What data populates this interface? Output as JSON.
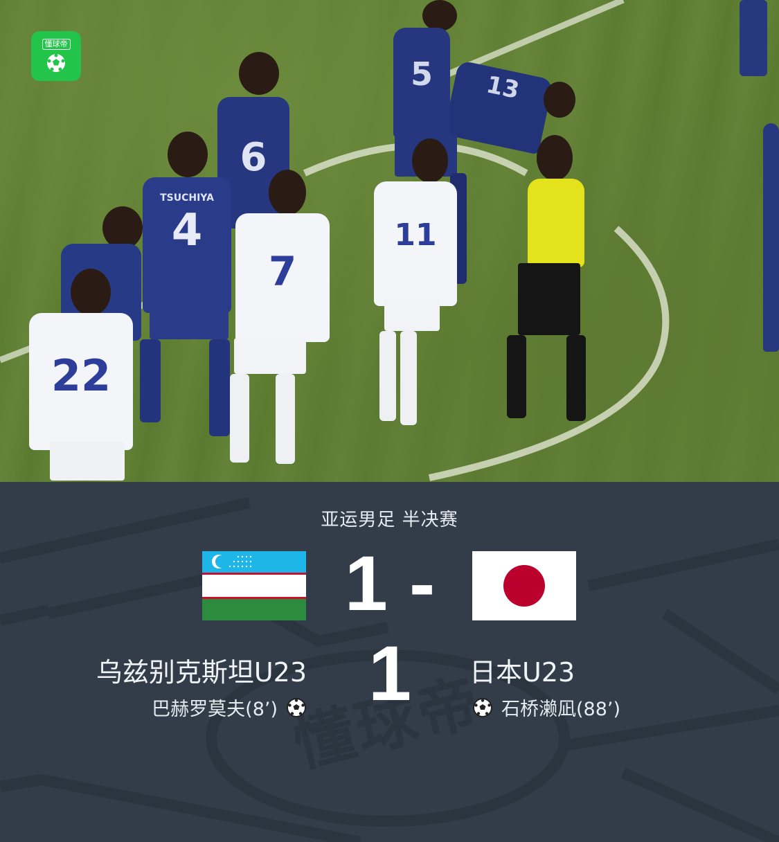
{
  "app": {
    "logo_text": "懂球帝",
    "logo_icon": "soccer-ball-icon"
  },
  "match": {
    "competition": "亚运男足 半决赛",
    "score": "1 - 1",
    "watermark": "懂球帝"
  },
  "home": {
    "name": "乌兹别克斯坦U23",
    "flag": "uzbekistan-flag-icon",
    "scorers": [
      {
        "text": "巴赫罗莫夫(8’)",
        "icon": "soccer-ball-icon"
      }
    ],
    "colors": {
      "blue": "#1eb5e8",
      "white": "#ffffff",
      "green": "#2d8b3f",
      "red": "#c8102e"
    }
  },
  "away": {
    "name": "日本U23",
    "flag": "japan-flag-icon",
    "scorers": [
      {
        "text": "石桥濑凪(88’)",
        "icon": "soccer-ball-icon"
      }
    ],
    "colors": {
      "white": "#ffffff",
      "red": "#bc002d"
    }
  },
  "photo": {
    "jersey_numbers": [
      "22",
      "4",
      "7",
      "11",
      "5",
      "13"
    ],
    "jersey_names": [
      "TSUCHIYA"
    ]
  },
  "theme": {
    "panel_bg": "#323d49",
    "brand_green": "#22c44a"
  }
}
